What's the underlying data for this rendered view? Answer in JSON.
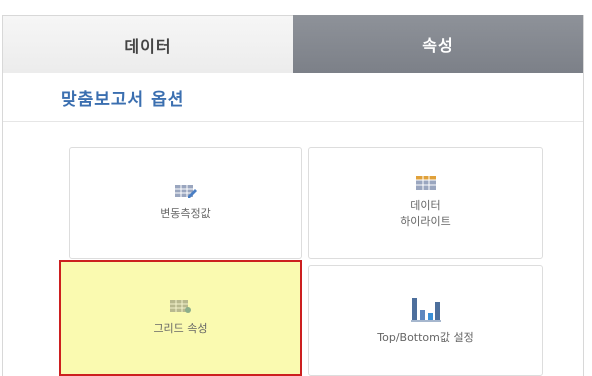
{
  "tabs": {
    "data_label": "데이터",
    "properties_label": "속성"
  },
  "section": {
    "title": "맞춤보고서 옵션"
  },
  "options": [
    {
      "label": "변동측정값",
      "icon": "table-edit-icon"
    },
    {
      "label": "데이터\n하이라이트",
      "icon": "table-highlight-icon"
    },
    {
      "label": "그리드 속성",
      "icon": "grid-settings-icon",
      "selected": true
    },
    {
      "label": "Top/Bottom값 설정",
      "icon": "bar-chart-icon"
    }
  ],
  "colors": {
    "tab_active_bg": "#82868e",
    "title_blue": "#3b6fb0",
    "selection_border": "#cc1f1f",
    "selection_fill": "#fafab0"
  }
}
